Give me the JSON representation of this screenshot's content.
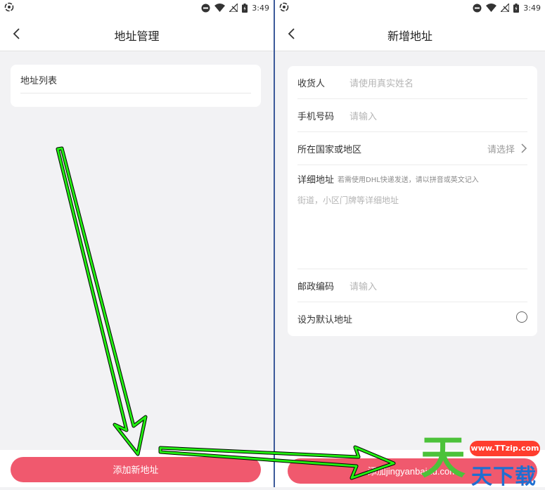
{
  "status_bar": {
    "time": "3:49"
  },
  "left_screen": {
    "title": "地址管理",
    "list_card": {
      "label": "地址列表"
    },
    "add_button": "添加新地址"
  },
  "right_screen": {
    "title": "新增地址",
    "form": {
      "recipient": {
        "label": "收货人",
        "placeholder": "请使用真实姓名"
      },
      "phone": {
        "label": "手机号码",
        "placeholder": "请输入"
      },
      "region": {
        "label": "所在国家或地区",
        "value": "请选择"
      },
      "address": {
        "label": "详细地址",
        "hint": "若需使用DHL快递发送，请以拼音或英文记入",
        "placeholder": "街道，小区门牌等详细地址"
      },
      "postcode": {
        "label": "邮政编码",
        "placeholder": "请输入"
      },
      "default": {
        "label": "设为默认地址"
      }
    },
    "add_button": "添加jingyanbaidu.com"
  },
  "watermark": {
    "big": "天",
    "url": "www.TTzip.com",
    "small": "天下载"
  },
  "annotation": {
    "arrow_color": "#22ee11",
    "accent": "#f0596e"
  }
}
